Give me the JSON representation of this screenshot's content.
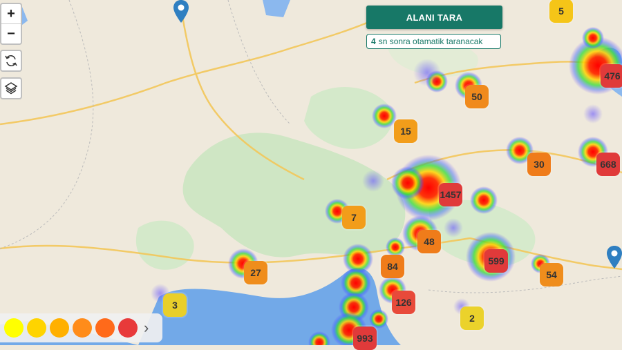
{
  "scan_button": {
    "label": "ALANI TARA"
  },
  "auto_scan": {
    "seconds": "4",
    "message": "sn sonra otamatik taranacak"
  },
  "zoom": {
    "in_label": "+",
    "out_label": "−"
  },
  "clusters": [
    {
      "count": "5",
      "color": "#f5c518"
    },
    {
      "count": "476",
      "color": "#e03a3a"
    },
    {
      "count": "50",
      "color": "#f08a1c"
    },
    {
      "count": "15",
      "color": "#f29d1a"
    },
    {
      "count": "30",
      "color": "#ef7c1a"
    },
    {
      "count": "668",
      "color": "#e03a3a"
    },
    {
      "count": "1457",
      "color": "#e03a3a"
    },
    {
      "count": "7",
      "color": "#f29d1a"
    },
    {
      "count": "48",
      "color": "#ef7c1a"
    },
    {
      "count": "599",
      "color": "#e03a3a"
    },
    {
      "count": "27",
      "color": "#ef8d1c"
    },
    {
      "count": "84",
      "color": "#ef7c1a"
    },
    {
      "count": "54",
      "color": "#ef8d1c"
    },
    {
      "count": "126",
      "color": "#e84a3a"
    },
    {
      "count": "3",
      "color": "#e9cf2a"
    },
    {
      "count": "2",
      "color": "#ebd22b"
    },
    {
      "count": "993",
      "color": "#e03a3a"
    }
  ],
  "legend": {
    "colors": [
      "#ffff00",
      "#ffd400",
      "#ffb000",
      "#ff8c1a",
      "#ff6a1a",
      "#e83a3a"
    ]
  },
  "icons": [
    "map-pin-icon",
    "refresh-icon",
    "layers-icon",
    "chevron-right-icon"
  ]
}
